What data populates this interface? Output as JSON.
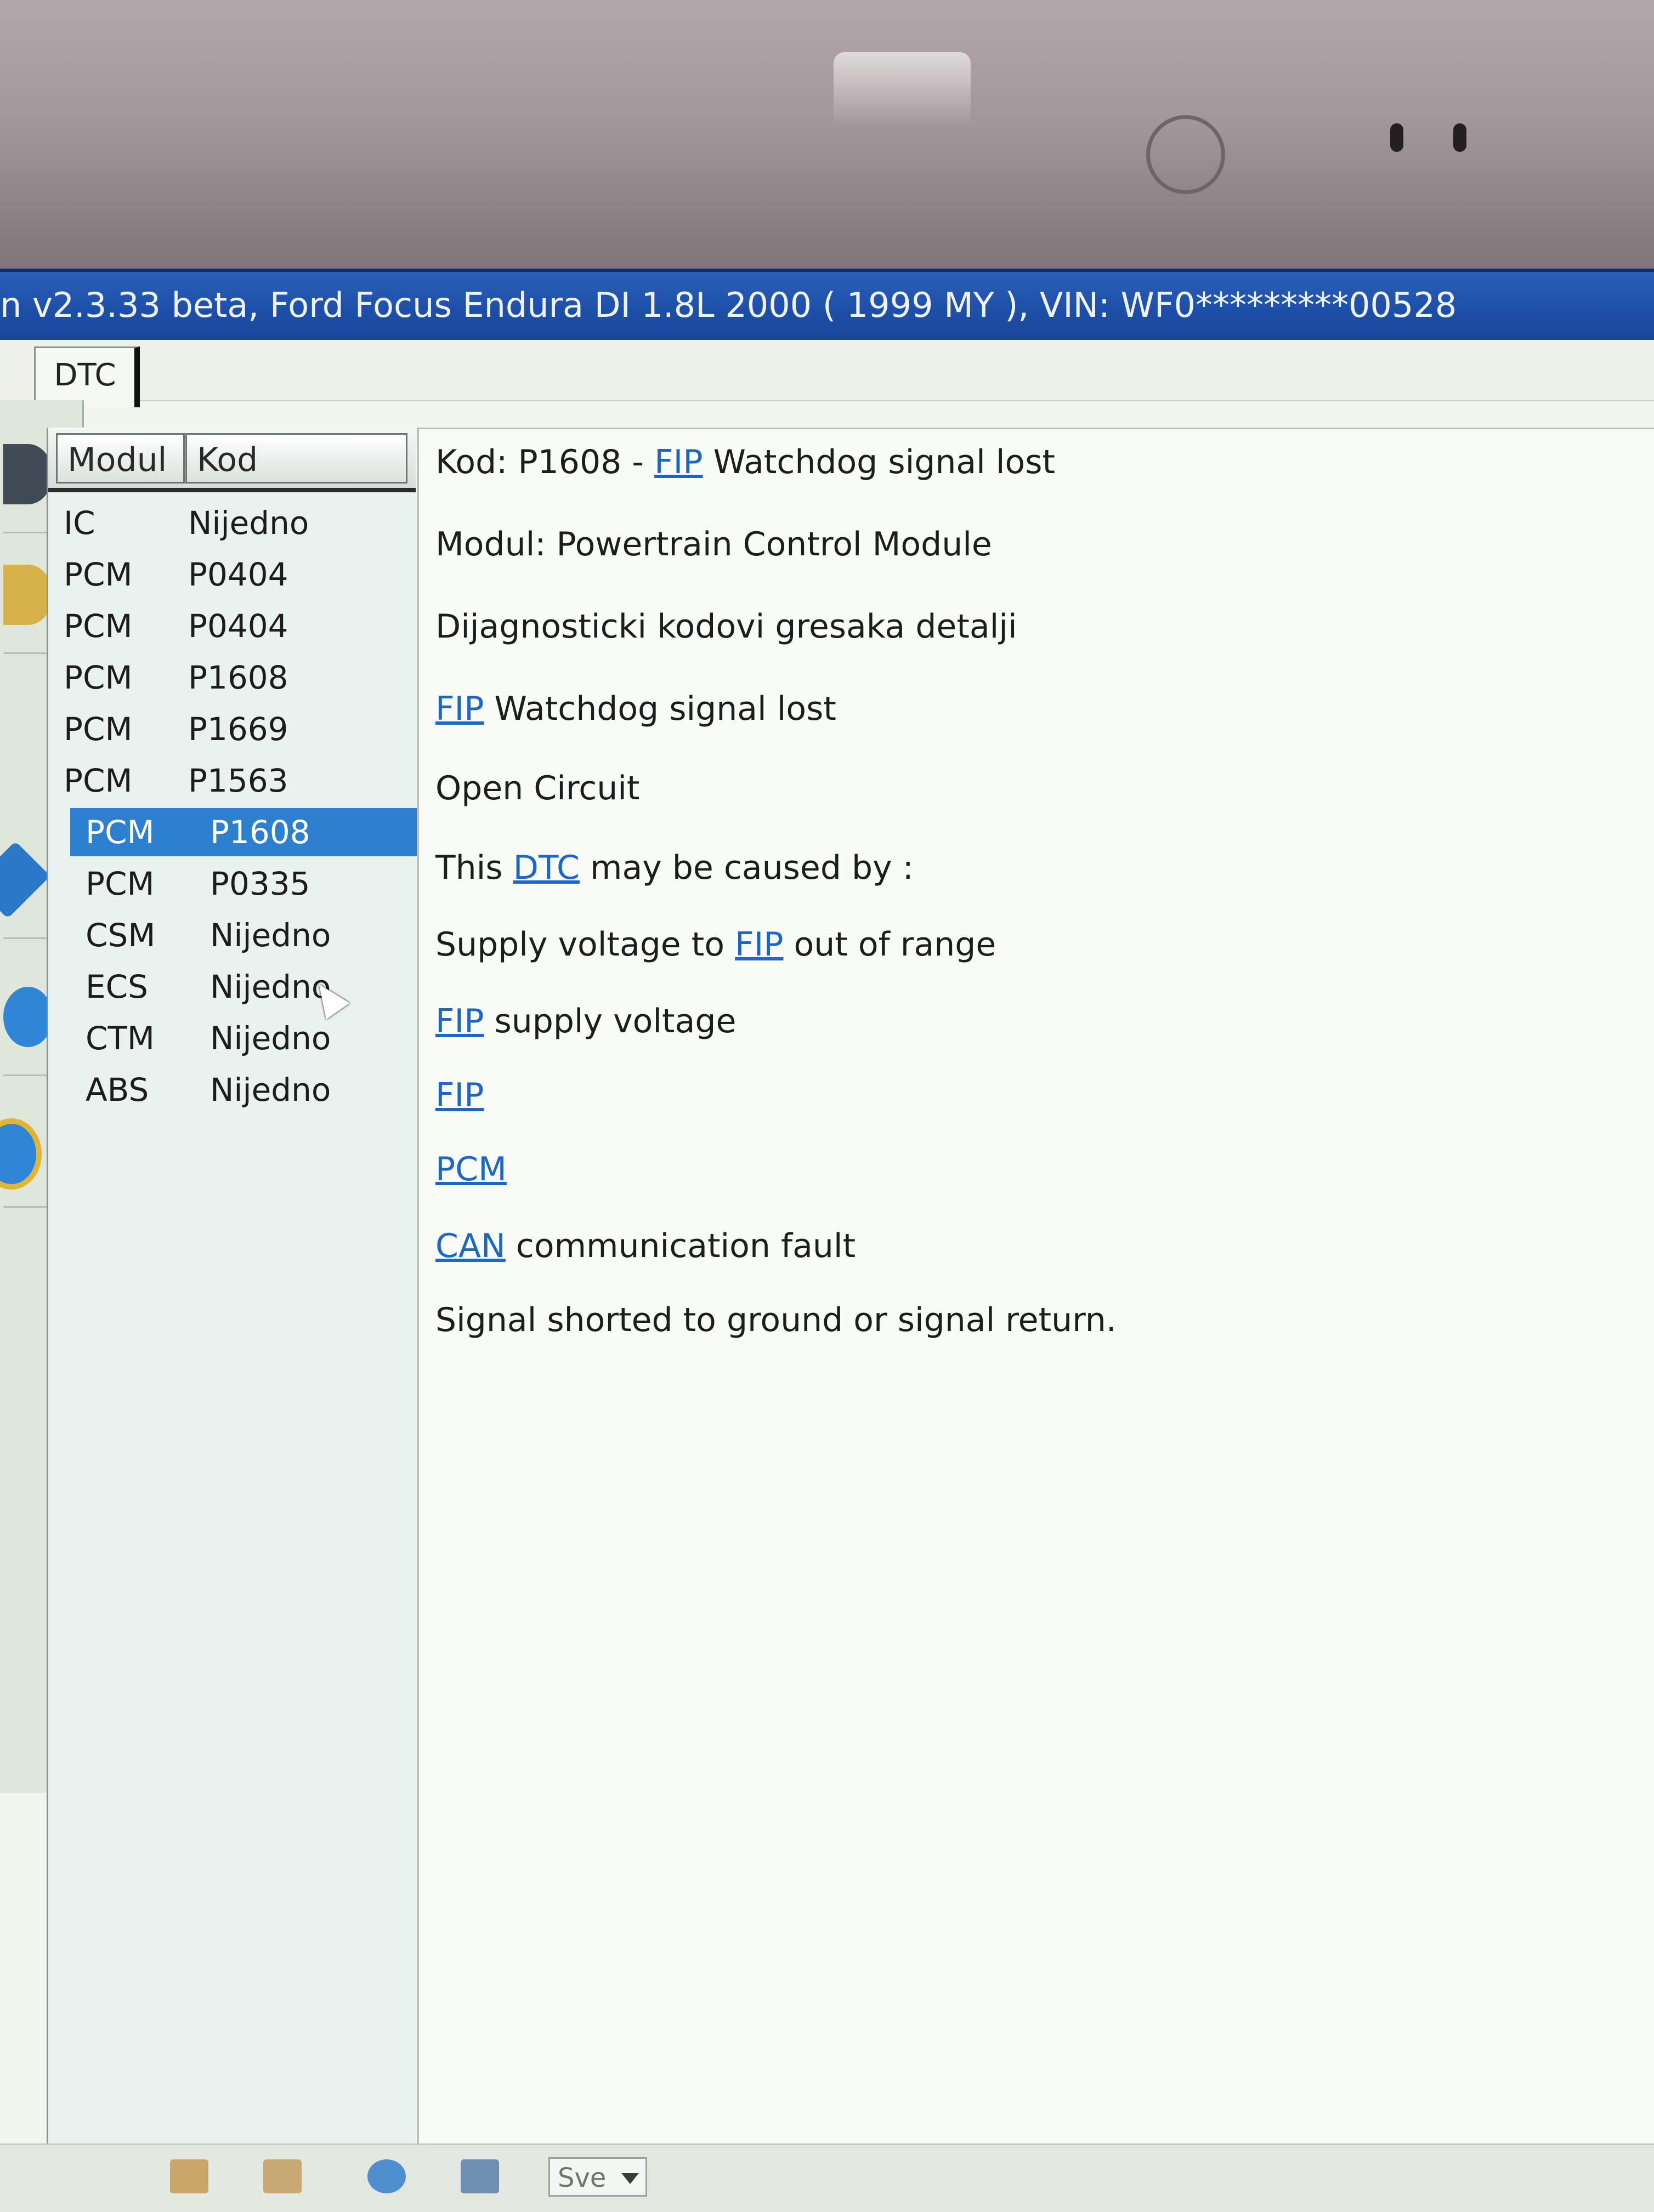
{
  "window": {
    "title": "n v2.3.33 beta, Ford Focus Endura DI 1.8L 2000 ( 1999 MY ), VIN: WF0*********00528"
  },
  "tabs": [
    {
      "label": "DTC"
    }
  ],
  "list": {
    "headers": {
      "module": "Modul",
      "code": "Kod"
    },
    "rows": [
      {
        "module": "IC",
        "code": "Nijedno"
      },
      {
        "module": "PCM",
        "code": "P0404"
      },
      {
        "module": "PCM",
        "code": "P0404"
      },
      {
        "module": "PCM",
        "code": "P1608"
      },
      {
        "module": "PCM",
        "code": "P1669"
      },
      {
        "module": "PCM",
        "code": "P1563"
      },
      {
        "module": "PCM",
        "code": "P1608",
        "selected": true
      },
      {
        "module": "PCM",
        "code": "P0335"
      },
      {
        "module": "CSM",
        "code": "Nijedno"
      },
      {
        "module": "ECS",
        "code": "Nijedno"
      },
      {
        "module": "CTM",
        "code": "Nijedno"
      },
      {
        "module": "ABS",
        "code": "Nijedno"
      }
    ]
  },
  "detail": {
    "code_prefix": "Kod: P1608 - ",
    "code_link": "FIP",
    "code_suffix": " Watchdog signal lost",
    "module": "Modul: Powertrain Control Module",
    "section_title": "Dijagnosticki kodovi gresaka detalji",
    "line4_link": "FIP",
    "line4_text": " Watchdog signal lost",
    "line5": "Open Circuit",
    "line6_prefix": "This ",
    "line6_link": "DTC",
    "line6_suffix": " may be caused by :",
    "line7_prefix": "Supply voltage to ",
    "line7_link": "FIP",
    "line7_suffix": " out of range",
    "line8_link": "FIP",
    "line8_text": " supply voltage",
    "line9_link": "FIP",
    "line10_link": "PCM",
    "line11_link": "CAN",
    "line11_text": " communication fault",
    "line12": "Signal shorted to ground or signal return."
  },
  "statusbar": {
    "filter_value": "Sve"
  },
  "colors": {
    "titlebar": "#1d4fa8",
    "selection": "#2d7fcf",
    "link": "#1a66c9"
  },
  "icons": {
    "sidebar": [
      "tool-icon",
      "wrench-icon",
      "chip-icon",
      "gear-icon",
      "help-icon"
    ],
    "statusbar": [
      "print-icon",
      "print-preview-icon",
      "erase-icon",
      "save-icon"
    ]
  }
}
